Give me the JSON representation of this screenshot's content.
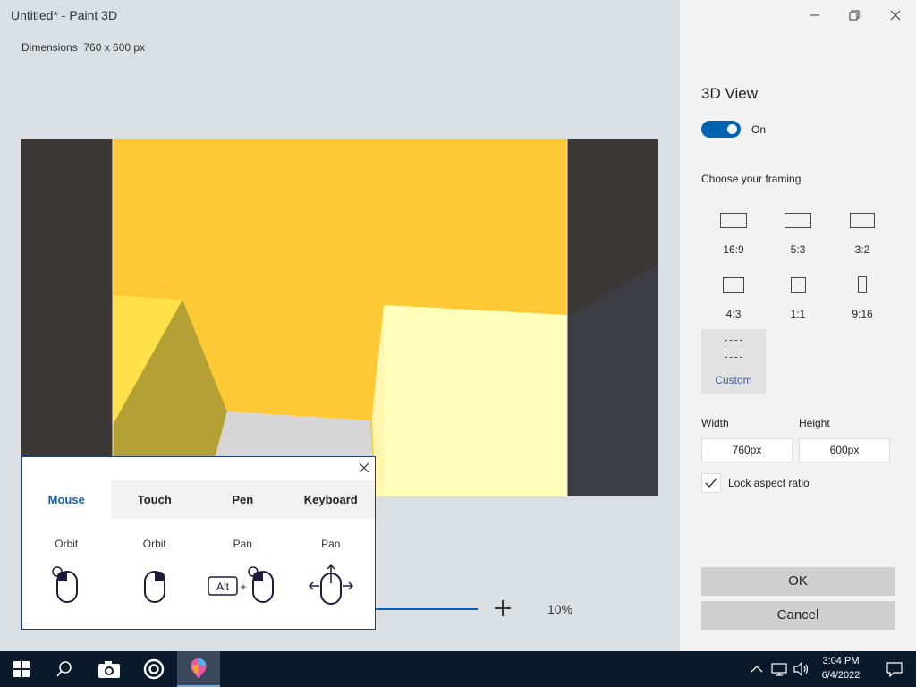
{
  "app": {
    "title": "Untitled* - Paint 3D",
    "dimensions": "Dimensions  760 x 600 px"
  },
  "zoom": {
    "level": "10%"
  },
  "help_popup": {
    "tabs": [
      "Mouse",
      "Touch",
      "Pen",
      "Keyboard"
    ],
    "active_tab": "Mouse",
    "actions": [
      {
        "label": "Orbit",
        "icon": "mouse-left-click-icon"
      },
      {
        "label": "Orbit",
        "icon": "mouse-right-click-icon"
      },
      {
        "label": "Pan",
        "icon": "alt-plus-mouse-icon",
        "key": "Alt",
        "plus": "+"
      },
      {
        "label": "Pan",
        "icon": "mouse-move-arrows-icon"
      }
    ]
  },
  "panel": {
    "title": "3D View",
    "toggle_label": "On",
    "toggle_on": true,
    "framing_label": "Choose your framing",
    "framings": [
      "16:9",
      "5:3",
      "3:2",
      "4:3",
      "1:1",
      "9:16",
      "Custom"
    ],
    "selected_framing": "Custom",
    "width_label": "Width",
    "height_label": "Height",
    "width_value": "760px",
    "height_value": "600px",
    "lock_label": "Lock aspect ratio",
    "lock_checked": true,
    "ok_label": "OK",
    "cancel_label": "Cancel"
  },
  "taskbar": {
    "time": "3:04 PM",
    "date": "6/4/2022"
  },
  "colors": {
    "accent": "#0063b1",
    "canvas_yellow": "#ffc936",
    "canvas_pale": "#ffffbc"
  }
}
